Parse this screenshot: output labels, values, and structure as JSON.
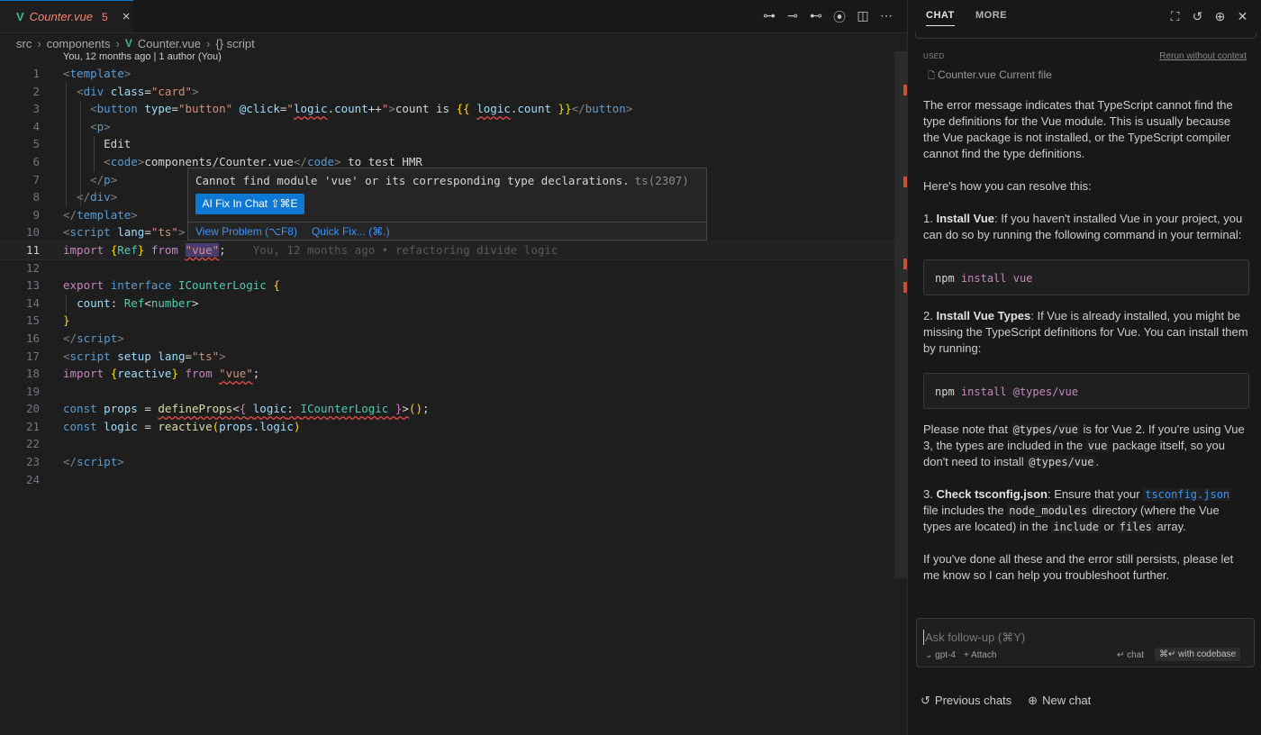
{
  "tab": {
    "icon": "V",
    "filename": "Counter.vue",
    "problem_count": "5",
    "close": "×"
  },
  "editor_actions": [
    "⊶",
    "⊸",
    "⊷",
    "⦿",
    "◫",
    "⋯"
  ],
  "breadcrumb": {
    "parts": [
      "src",
      "components"
    ],
    "file": "Counter.vue",
    "symbol": "{} script",
    "sep": "›"
  },
  "blame": "You, 12 months ago | 1 author (You)",
  "line_numbers": [
    "1",
    "2",
    "3",
    "4",
    "5",
    "6",
    "7",
    "8",
    "9",
    "10",
    "11",
    "12",
    "13",
    "14",
    "15",
    "16",
    "17",
    "18",
    "19",
    "20",
    "21",
    "22",
    "23",
    "24"
  ],
  "ghost_blame": "You, 12 months ago • refactoring divide logic",
  "hover": {
    "message": "Cannot find module 'vue' or its corresponding type declarations.",
    "code": "ts(2307)",
    "fix_button": "AI Fix In Chat ⇧⌘E",
    "view_problem": "View Problem (⌥F8)",
    "quick_fix": "Quick Fix... (⌘.)"
  },
  "chat": {
    "tabs": {
      "chat": "CHAT",
      "more": "MORE"
    },
    "used_label": "USED",
    "rerun": "Rerun without context",
    "context_file": "Counter.vue Current file",
    "answer": {
      "p1": "The error message indicates that TypeScript cannot find the type definitions for the Vue module. This is usually because the Vue package is not installed, or the TypeScript compiler cannot find the type definitions.",
      "p2": "Here's how you can resolve this:",
      "step1_num": "1.",
      "step1_title": "Install Vue",
      "step1_text": ": If you haven't installed Vue in your project, you can do so by running the following command in your terminal:",
      "cmd1_npm": "npm",
      "cmd1_args": "install vue",
      "step2_num": "2.",
      "step2_title": "Install Vue Types",
      "step2_text": ": If Vue is already installed, you might be missing the TypeScript definitions for Vue. You can install them by running:",
      "cmd2_npm": "npm",
      "cmd2_args": "install @types/vue",
      "note_a": "Please note that ",
      "note_code1": "@types/vue",
      "note_b": " is for Vue 2. If you're using Vue 3, the types are included in the ",
      "note_code2": "vue",
      "note_c": " package itself, so you don't need to install ",
      "note_code3": "@types/vue",
      "note_d": ".",
      "step3_num": "3.",
      "step3_title": "Check tsconfig.json",
      "step3_a": ": Ensure that your ",
      "step3_link": "tsconfig.json",
      "step3_b": " file includes the ",
      "step3_code1": "node_modules",
      "step3_c": " directory (where the Vue types are located) in the ",
      "step3_code2": "include",
      "step3_d": " or ",
      "step3_code3": "files",
      "step3_e": " array.",
      "closing": "If you've done all these and the error still persists, please let me know so I can help you troubleshoot further."
    },
    "input_placeholder": "Ask follow-up (⌘Y)",
    "model": "⌄ gpt-4",
    "attach": "+ Attach",
    "send_chat": "↵ chat",
    "send_codebase": "⌘↵ with codebase",
    "previous_chats": "Previous chats",
    "new_chat": "New chat"
  },
  "colors": {
    "accent": "#0e78d5",
    "error": "#f14c4c",
    "vue_green": "#41b883",
    "link": "#3794ff"
  }
}
